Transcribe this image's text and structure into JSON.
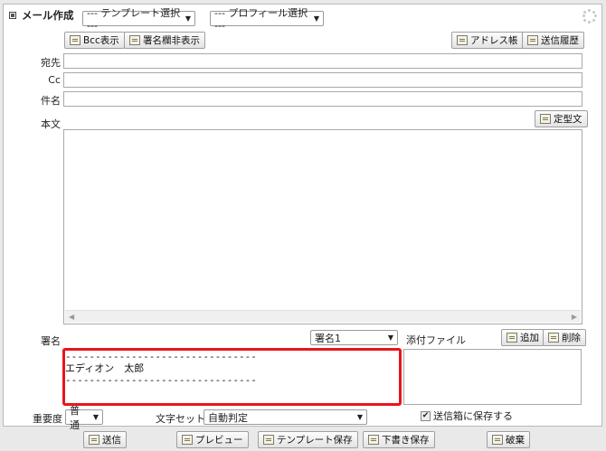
{
  "header": {
    "title": "メール作成",
    "template_select": "--- テンプレート選択 ---",
    "profile_select": "--- プロフィール選択 ---"
  },
  "toolbar": {
    "bcc_label": "Bcc表示",
    "signature_toggle_label": "署名欄非表示",
    "address_book_label": "アドレス帳",
    "send_history_label": "送信履歴"
  },
  "fields": {
    "to_label": "宛先",
    "cc_label": "Cc",
    "subject_label": "件名",
    "body_label": "本文",
    "fixed_phrase_label": "定型文"
  },
  "signature": {
    "label": "署名",
    "selected": "署名1",
    "text": "--------------------------------\nエディオン　太郎\n--------------------------------"
  },
  "attachments": {
    "label": "添付ファイル",
    "add_label": "追加",
    "delete_label": "削除"
  },
  "options": {
    "priority_label": "重要度",
    "priority_value": "普通",
    "charset_label": "文字セット",
    "charset_value": "自動判定",
    "save_sent_label": "送信箱に保存する",
    "save_sent_checked": "✔"
  },
  "actions": {
    "send_label": "送信",
    "preview_label": "プレビュー",
    "save_template_label": "テンプレート保存",
    "save_draft_label": "下書き保存",
    "discard_label": "破棄"
  }
}
